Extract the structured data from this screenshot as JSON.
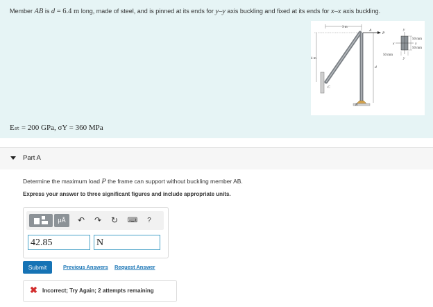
{
  "problem": {
    "statement": {
      "part1": "Member ",
      "member": "AB",
      "part2": " is ",
      "d_var": "d",
      "eq": " = 6.4 ",
      "unit": "m",
      "part3": " long, made of steel, and is pinned at its ends for ",
      "axis1": "y–y",
      "part4": " axis buckling and fixed at its ends for ",
      "axis2": "x–x",
      "part5": " axis buckling."
    },
    "properties": "Eₛₜ = 200 GPa, σY = 360 MPa"
  },
  "figure": {
    "dim_top": "3 m",
    "dim_left": "4 m",
    "label_A": "A",
    "label_B": "B",
    "label_C": "C",
    "label_P": "P",
    "label_d": "d",
    "section": {
      "y_top": "y",
      "y_bottom": "y",
      "x_left": "x",
      "x_right": "x",
      "dim_50_top": "50 mm",
      "dim_50_right": "50 mm",
      "dim_50_left": "50 mm"
    }
  },
  "part": {
    "title": "Part A",
    "question_prefix": "Determine the maximum load ",
    "question_var": "P",
    "question_suffix": " the frame can support without buckling member AB.",
    "instruction": "Express your answer to three significant figures and include appropriate units."
  },
  "editor": {
    "mu_button": "μÅ",
    "help_button": "?",
    "value": "42.85",
    "unit": "N"
  },
  "actions": {
    "submit": "Submit",
    "previous_answers": "Previous Answers",
    "request_answer": "Request Answer"
  },
  "feedback": {
    "icon": "✖",
    "message": "Incorrect; Try Again; 2 attempts remaining"
  }
}
